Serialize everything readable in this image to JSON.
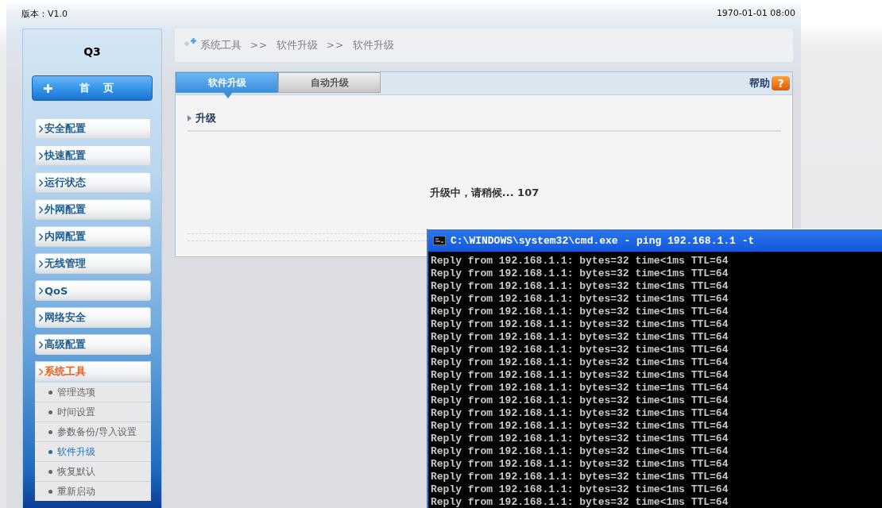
{
  "header": {
    "version": "版本：V1.0",
    "datetime": "1970-01-01 08:00"
  },
  "sidebar": {
    "title": "Q3",
    "home": {
      "label": "首 页"
    },
    "items": [
      {
        "label": "安全配置",
        "expanded": false
      },
      {
        "label": "快速配置",
        "expanded": false
      },
      {
        "label": "运行状态",
        "expanded": false
      },
      {
        "label": "外网配置",
        "expanded": false
      },
      {
        "label": "内网配置",
        "expanded": false
      },
      {
        "label": "无线管理",
        "expanded": false
      },
      {
        "label": "QoS",
        "expanded": false
      },
      {
        "label": "网络安全",
        "expanded": false
      },
      {
        "label": "高级配置",
        "expanded": false
      },
      {
        "label": "系统工具",
        "expanded": true,
        "children": [
          {
            "label": "管理选项",
            "selected": false
          },
          {
            "label": "时间设置",
            "selected": false
          },
          {
            "label": "参数备份/导入设置",
            "selected": false
          },
          {
            "label": "软件升级",
            "selected": true
          },
          {
            "label": "恢复默认",
            "selected": false
          },
          {
            "label": "重新启动",
            "selected": false
          }
        ]
      }
    ]
  },
  "breadcrumb": {
    "items": [
      "系统工具",
      "软件升级",
      "软件升级"
    ],
    "separator": ">>"
  },
  "tabs": [
    {
      "label": "软件升级",
      "selected": true
    },
    {
      "label": "自动升级",
      "selected": false
    }
  ],
  "help": {
    "label": "帮助",
    "icon_text": "?"
  },
  "section": {
    "title": "升级"
  },
  "status_message": "升级中，请稍候... 107",
  "terminal": {
    "title": "C:\\WINDOWS\\system32\\cmd.exe - ping 192.168.1.1 -t",
    "lines": [
      "Reply from 192.168.1.1: bytes=32 time<1ms TTL=64",
      "Reply from 192.168.1.1: bytes=32 time<1ms TTL=64",
      "Reply from 192.168.1.1: bytes=32 time<1ms TTL=64",
      "Reply from 192.168.1.1: bytes=32 time<1ms TTL=64",
      "Reply from 192.168.1.1: bytes=32 time<1ms TTL=64",
      "Reply from 192.168.1.1: bytes=32 time<1ms TTL=64",
      "Reply from 192.168.1.1: bytes=32 time<1ms TTL=64",
      "Reply from 192.168.1.1: bytes=32 time<1ms TTL=64",
      "Reply from 192.168.1.1: bytes=32 time<1ms TTL=64",
      "Reply from 192.168.1.1: bytes=32 time<1ms TTL=64",
      "Reply from 192.168.1.1: bytes=32 time=1ms TTL=64",
      "Reply from 192.168.1.1: bytes=32 time<1ms TTL=64",
      "Reply from 192.168.1.1: bytes=32 time<1ms TTL=64",
      "Reply from 192.168.1.1: bytes=32 time<1ms TTL=64",
      "Reply from 192.168.1.1: bytes=32 time<1ms TTL=64",
      "Reply from 192.168.1.1: bytes=32 time<1ms TTL=64",
      "Reply from 192.168.1.1: bytes=32 time<1ms TTL=64",
      "Reply from 192.168.1.1: bytes=32 time<1ms TTL=64",
      "Reply from 192.168.1.1: bytes=32 time<1ms TTL=64",
      "Reply from 192.168.1.1: bytes=32 time<1ms TTL=64"
    ]
  }
}
